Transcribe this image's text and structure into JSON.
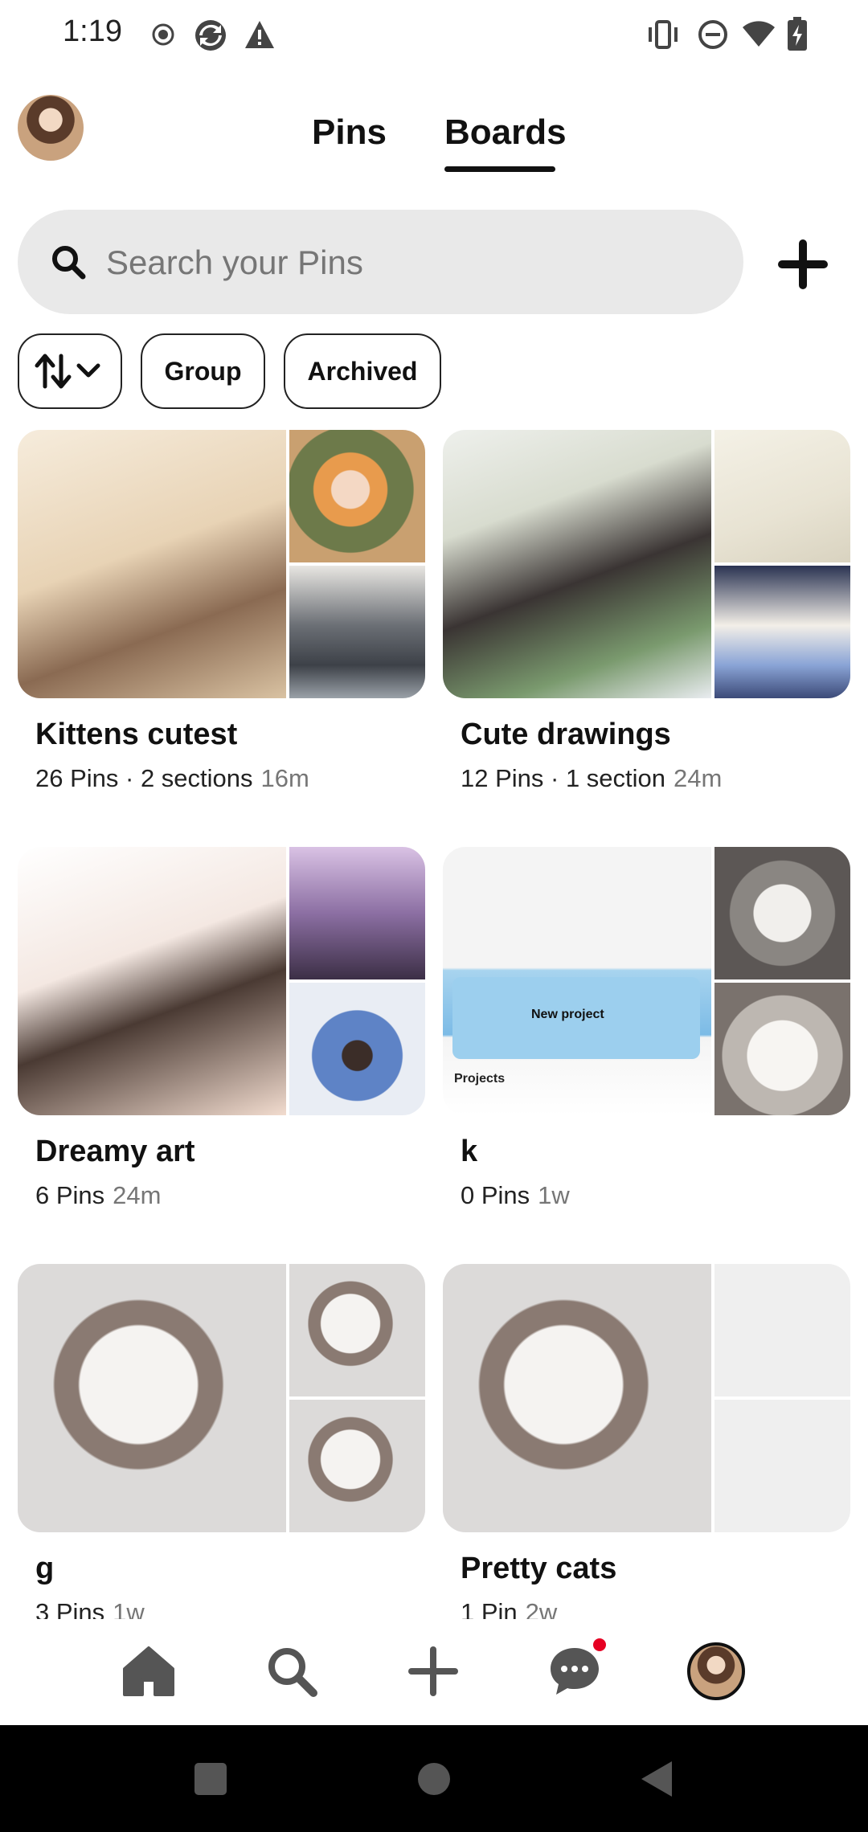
{
  "status_bar": {
    "time": "1:19",
    "left_icons": [
      "record-icon",
      "sync-icon",
      "warning-icon"
    ],
    "right_icons": [
      "vibrate-icon",
      "do-not-disturb-icon",
      "wifi-icon",
      "battery-charging-icon"
    ]
  },
  "header": {
    "tabs": [
      {
        "label": "Pins",
        "active": false
      },
      {
        "label": "Boards",
        "active": true
      }
    ]
  },
  "search": {
    "placeholder": "Search your Pins"
  },
  "filters": {
    "sort_icon": "sort-arrows-icon",
    "chips": [
      "Group",
      "Archived"
    ]
  },
  "boards": [
    {
      "title": "Kittens cutest",
      "meta": "26 Pins · 2 sections",
      "age": "16m"
    },
    {
      "title": "Cute drawings",
      "meta": "12 Pins · 1 section",
      "age": "24m"
    },
    {
      "title": "Dreamy art",
      "meta": "6 Pins",
      "age": "24m"
    },
    {
      "title": "k",
      "meta": "0 Pins",
      "age": "1w",
      "cover_text": {
        "button": "New project",
        "section": "Projects"
      }
    },
    {
      "title": "g",
      "meta": "3 Pins",
      "age": "1w"
    },
    {
      "title": "Pretty cats",
      "meta": "1 Pin",
      "age": "2w"
    }
  ],
  "bottom_nav": {
    "items": [
      "home-icon",
      "search-icon",
      "plus-icon",
      "chat-icon",
      "profile-avatar"
    ],
    "messages_has_notification": true
  },
  "colors": {
    "accent": "#111111",
    "notification": "#e60023",
    "search_bg": "#e9e9e9",
    "muted_text": "#767676"
  }
}
